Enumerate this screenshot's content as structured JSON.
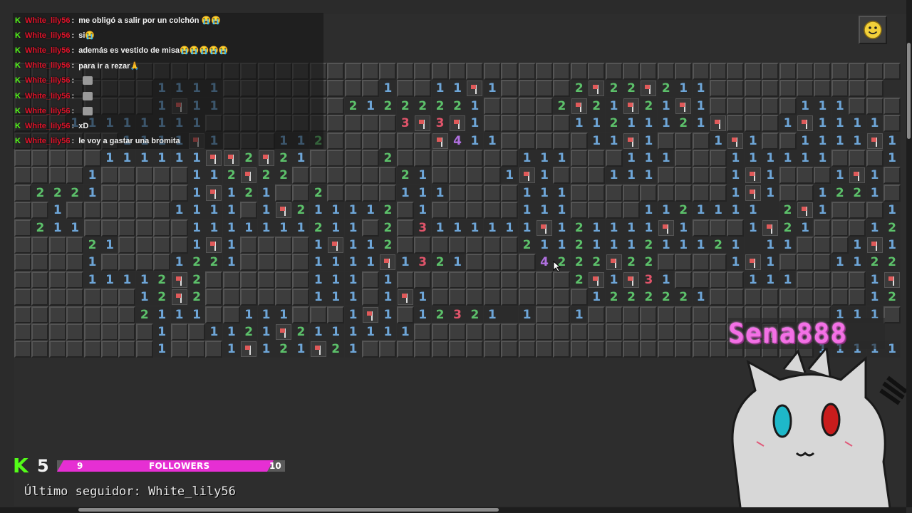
{
  "game": {
    "smiley": "smiley-face-icon",
    "board_rows": [
      "#########################################################",
      "########1111#########1##11F1####2F22F211##########",
      "########1F11#######21222221####2F21F21F1#####111###",
      "###11111111###########3F3F1#####11211121F###1F1111##",
      "######1111F1###112######F411#####11F1###1F1##1111F1##",
      "#####111111FF2F21####2#######111###111###111111###1121 1#",
      "####1#####112F22######21####1F1###111####1F1###1F1##1",
      "#2221#####1F121##2####111####111#########1F1##1221##113 22",
      "##1######1111#1F211112#1#####111####1121111 2F1###1F2F1#",
      "#211######1111111211#2#3111111F121111F1###1F21###12221 1",
      "####21####1F1####1F112#######2112111211121 11###1F1###111",
      "####1####1221####1111F1321####4222F22####1F1###1122222F11",
      "####11112F2######111#1##########2F1F31####111####1F1F21 2",
      "#######12F2######111#1F1#########1222221#########1222 1F1",
      "#######2111##111###1F1#12321 1##1##############111#1111",
      "########1##1121F2111111###################1F1",
      "########1###1F121F21##########################1111111 1"
    ],
    "cursor": "pointer-arrow-icon"
  },
  "chat": {
    "badge": "K",
    "messages": [
      {
        "user": "White_lily56",
        "text": "me obligó a salir por un colchón 😭😭"
      },
      {
        "user": "White_lily56",
        "text": "si😭"
      },
      {
        "user": "White_lily56",
        "text": "además es vestido de misa😭😭😭😭😭"
      },
      {
        "user": "White_lily56",
        "text": "para ir a rezar🙏"
      },
      {
        "user": "White_lily56",
        "text": "",
        "emote": true
      },
      {
        "user": "White_lily56",
        "text": "",
        "emote": true
      },
      {
        "user": "White_lily56",
        "text": "",
        "emote": true
      },
      {
        "user": "White_lily56",
        "text": "xD"
      },
      {
        "user": "White_lily56",
        "text": "le voy a gastar una bromita"
      }
    ]
  },
  "follower_goal": {
    "platform_logo": "K",
    "count": "5",
    "start": "9",
    "label": "FOLLOWERS",
    "end": "10",
    "progress": 0.95
  },
  "last_follower": "Último seguidor: White_lily56",
  "streamer": {
    "name": "Sena888",
    "avatar": "cat-avatar-icon"
  },
  "colors": {
    "n1": "#6ea6d8",
    "n2": "#5cc06a",
    "n3": "#e0546a",
    "n4": "#b070e0",
    "flag": "#e05a5a",
    "accent": "#e62fd3",
    "kick": "#53fc18"
  }
}
